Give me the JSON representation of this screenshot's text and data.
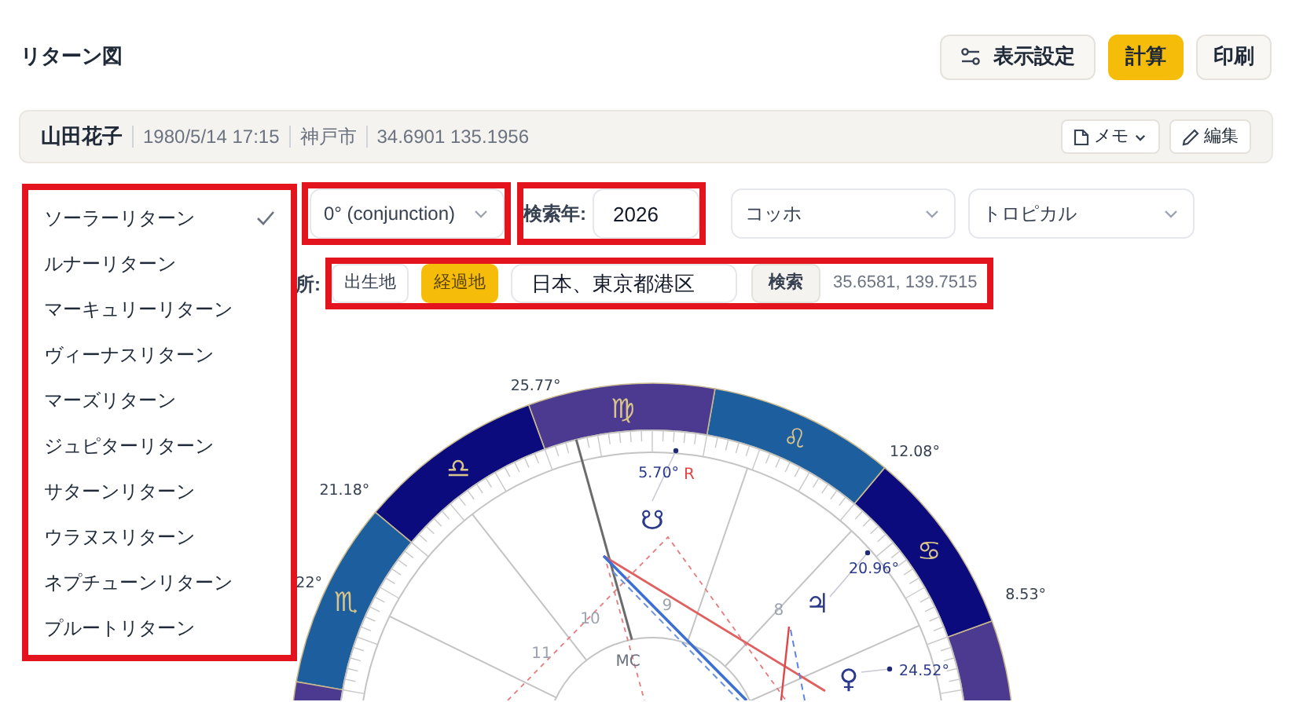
{
  "page_title": "リターン図",
  "toolbar": [
    {
      "label": "表示設定",
      "kind": "settings"
    },
    {
      "label": "計算",
      "kind": "primary"
    },
    {
      "label": "印刷",
      "kind": "plain"
    }
  ],
  "profile": {
    "name": "山田花子",
    "birth": "1980/5/14 17:15",
    "place": "神戸市",
    "coords": "34.6901 135.1956",
    "memo_button": "メモ",
    "edit_button": "編集"
  },
  "return_types": {
    "highlighted": true,
    "items": [
      {
        "label": "ソーラーリターン",
        "selected": true
      },
      {
        "label": "ルナーリターン",
        "selected": false
      },
      {
        "label": "マーキュリーリターン",
        "selected": false
      },
      {
        "label": "ヴィーナスリターン",
        "selected": false
      },
      {
        "label": "マーズリターン",
        "selected": false
      },
      {
        "label": "ジュピターリターン",
        "selected": false
      },
      {
        "label": "サターンリターン",
        "selected": false
      },
      {
        "label": "ウラヌスリターン",
        "selected": false
      },
      {
        "label": "ネプチューンリターン",
        "selected": false
      },
      {
        "label": "プルートリターン",
        "selected": false
      }
    ]
  },
  "aspect_select": {
    "value": "0° (conjunction)",
    "highlighted": true
  },
  "year": {
    "label": "検索年:",
    "value": "2026",
    "highlighted": true
  },
  "house_system": {
    "value": "コッホ"
  },
  "zodiac": {
    "value": "トロピカル"
  },
  "location": {
    "label": "所:",
    "highlighted": true,
    "options": [
      {
        "label": "出生地",
        "selected": false
      },
      {
        "label": "経過地",
        "selected": true
      }
    ],
    "query": "日本、東京都港区",
    "search_button": "検索",
    "coords": "35.6581, 139.7515"
  },
  "chart": {
    "signs": [
      {
        "color": "#4b3a8f"
      },
      {
        "glyph": "♋",
        "color": "#0b0b7e"
      },
      {
        "glyph": "♌",
        "color": "#1c5e9e"
      },
      {
        "glyph": "♍",
        "color": "#4b3a8f"
      },
      {
        "glyph": "♎",
        "color": "#0b0b7e"
      },
      {
        "glyph": "♏",
        "color": "#1c5e9e"
      },
      {
        "color": "#4b3a8f"
      }
    ],
    "cusp_labels": [
      "8.53°",
      "12.08°",
      "25.77°",
      "21.18°",
      "22°"
    ],
    "planets": [
      {
        "glyph": "☋",
        "degree": "5.70°",
        "retrograde_mark": "R"
      },
      {
        "glyph": "♃",
        "degree": "20.96°"
      },
      {
        "glyph": "♀",
        "degree": "24.52°"
      }
    ],
    "house_numbers": [
      "8",
      "9",
      "10",
      "11"
    ],
    "mc_label": "MC"
  }
}
